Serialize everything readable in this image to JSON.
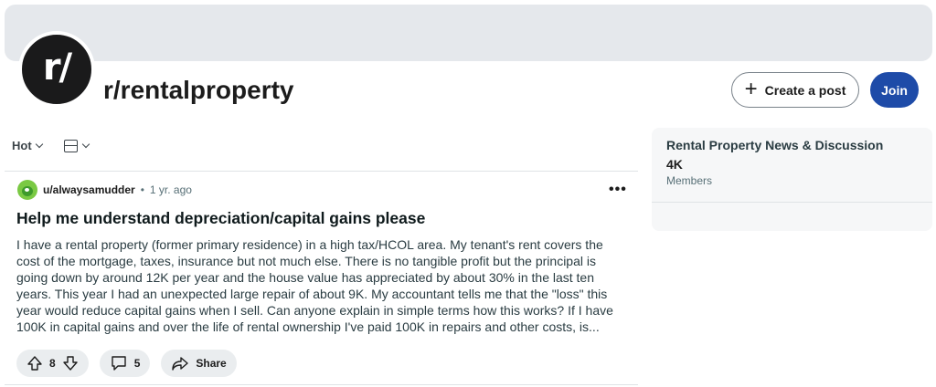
{
  "community": {
    "avatar_text": "r/",
    "name": "r/rentalproperty"
  },
  "header_actions": {
    "create_post_label": "Create a post",
    "create_icon": "plus-icon",
    "join_label": "Join",
    "join_color": "#1e4ba8"
  },
  "feed_controls": {
    "sort_label": "Hot",
    "view_icon": "layout-icon"
  },
  "post": {
    "username": "u/alwaysamudder",
    "separator": "•",
    "time": "1 yr. ago",
    "more_label": "•••",
    "title": "Help me understand depreciation/capital gains please",
    "body": "I have a rental property (former primary residence) in a high tax/HCOL area. My tenant's rent covers the cost of the mortgage, taxes, insurance but not much else. There is no tangible profit but the principal is going down by around 12K per year and the house value has appreciated by about 30% in the last ten years. This year I had an unexpected large repair of about 9K. My accountant tells me that the \"loss\" this year would reduce capital gains when I sell. Can anyone explain in simple terms how this works? If I have 100K in capital gains and over the life of rental ownership I've paid 100K in repairs and other costs, is...",
    "votes": "8",
    "comments": "5",
    "share_label": "Share"
  },
  "sidebar": {
    "title": "Rental Property News & Discussion",
    "members_count": "4K",
    "members_label": "Members"
  }
}
